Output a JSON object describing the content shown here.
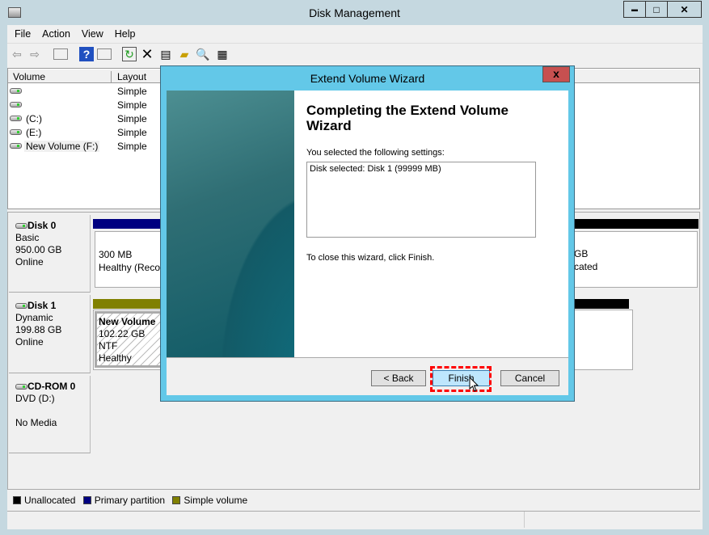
{
  "window": {
    "title": "Disk Management",
    "min": "▬",
    "max": "□",
    "close": "✕"
  },
  "menu": [
    "File",
    "Action",
    "View",
    "Help"
  ],
  "toolbar": [
    "back-icon",
    "forward-icon",
    "console-tree-icon",
    "help-icon",
    "action-pane-icon",
    "refresh-icon",
    "delete-icon",
    "properties-icon",
    "open-icon",
    "search-icon",
    "settings-icon"
  ],
  "list": {
    "headers": [
      "Volume",
      "Layout"
    ],
    "rows": [
      {
        "name": "",
        "layout": "Simple"
      },
      {
        "name": "",
        "layout": "Simple"
      },
      {
        "name": "(C:)",
        "layout": "Simple"
      },
      {
        "name": "(E:)",
        "layout": "Simple"
      },
      {
        "name": "New Volume (F:)",
        "layout": "Simple"
      }
    ]
  },
  "disks": [
    {
      "name": "Disk 0",
      "type": "Basic",
      "size": "950.00 GB",
      "status": "Online",
      "part1_size": "300 MB",
      "part1_status": "Healthy (Reco",
      "part2_size": "GB",
      "part2_status": "cated"
    },
    {
      "name": "Disk 1",
      "type": "Dynamic",
      "size": "199.88 GB",
      "status": "Online",
      "part1_name": "New Volume",
      "part1_size": "102.22 GB NTF",
      "part1_status": "Healthy"
    },
    {
      "name": "CD-ROM 0",
      "type": "DVD (D:)",
      "status": "No Media"
    }
  ],
  "legend": [
    {
      "label": "Unallocated",
      "color": "#000000"
    },
    {
      "label": "Primary partition",
      "color": "#000080"
    },
    {
      "label": "Simple volume",
      "color": "#808000"
    }
  ],
  "dialog": {
    "title": "Extend Volume Wizard",
    "close": "x",
    "heading": "Completing the Extend Volume Wizard",
    "selected_label": "You selected the following settings:",
    "settings": "Disk selected: Disk 1 (99999 MB)",
    "close_hint": "To close this wizard, click Finish.",
    "back": "< Back",
    "finish": "Finish",
    "cancel": "Cancel"
  },
  "colors": {
    "accent": "#63c8e8",
    "highlight": "#ff0000",
    "primary": "#000080",
    "simple": "#808000"
  }
}
